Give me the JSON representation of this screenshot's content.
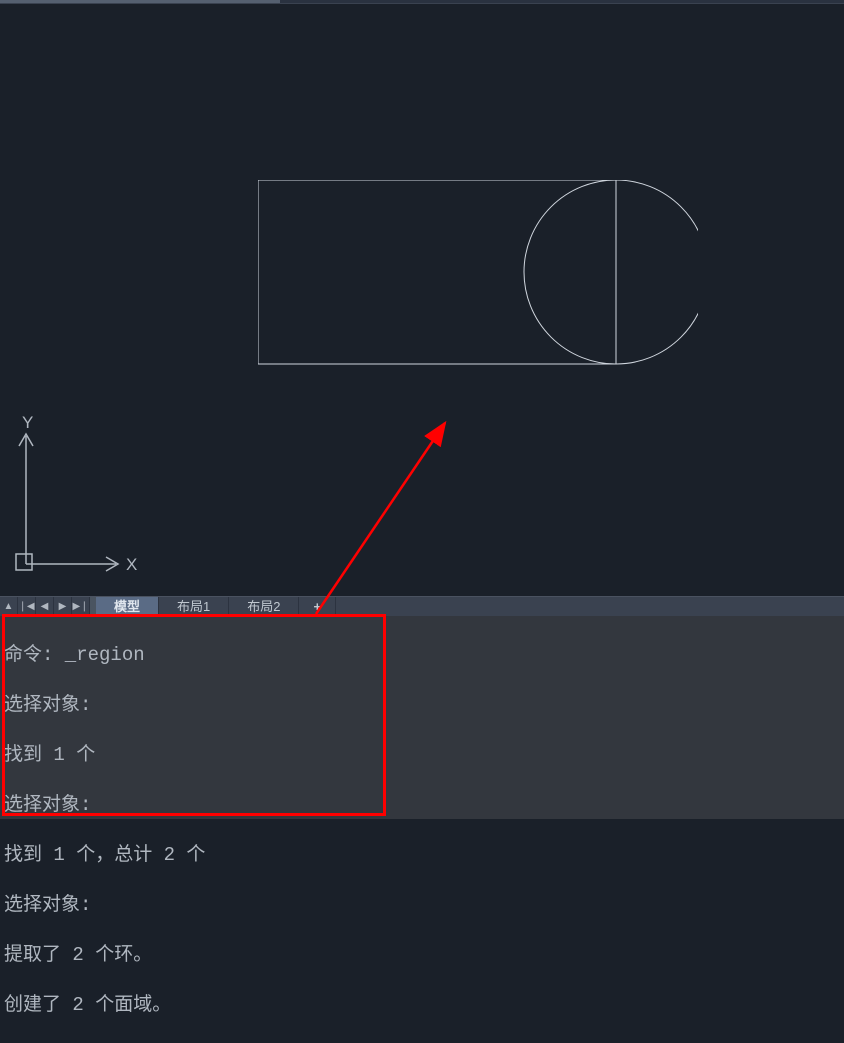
{
  "tabs": {
    "model": "模型",
    "layout1": "布局1",
    "layout2": "布局2",
    "add": "+"
  },
  "ucs": {
    "x": "X",
    "y": "Y"
  },
  "command": {
    "line1": "命令: _region",
    "line2": "选择对象:",
    "line3": "找到 1 个",
    "line4": "选择对象:",
    "line5": "找到 1 个，总计 2 个",
    "line6": "选择对象:",
    "line7": "提取了 2 个环。",
    "line8": "创建了 2 个面域。"
  },
  "nav": {
    "up": "▲",
    "first": "❘◀",
    "prev": "◀",
    "next": "▶",
    "last": "▶❘"
  }
}
